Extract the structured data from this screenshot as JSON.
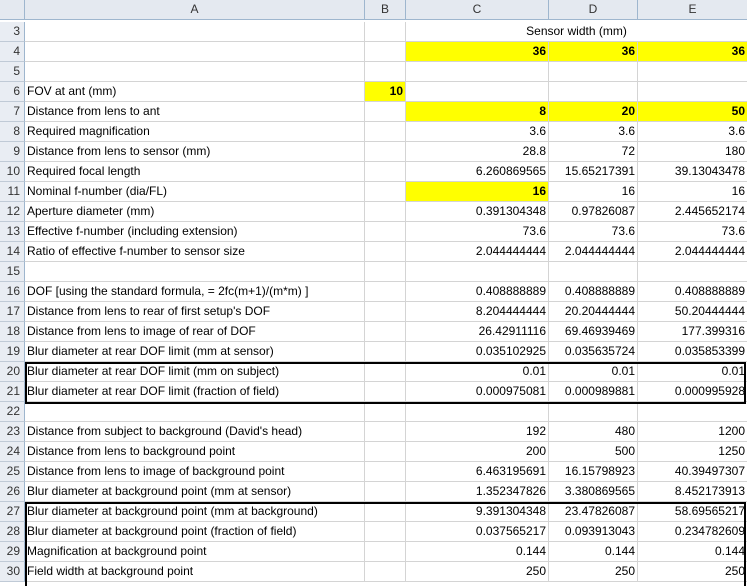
{
  "columns": [
    "A",
    "B",
    "C",
    "D",
    "E"
  ],
  "rows": [
    {
      "n": "3",
      "a": "",
      "b": "",
      "span": "Sensor width (mm)"
    },
    {
      "n": "4",
      "a": "",
      "b": "",
      "c": "36",
      "d": "36",
      "e": "36",
      "hl": [
        "c",
        "d",
        "e"
      ]
    },
    {
      "n": "5",
      "a": "",
      "b": "",
      "c": "",
      "d": "",
      "e": ""
    },
    {
      "n": "6",
      "a": "FOV at ant (mm)",
      "b": "10",
      "c": "",
      "d": "",
      "e": "",
      "hl": [
        "b"
      ]
    },
    {
      "n": "7",
      "a": "Distance from lens to ant",
      "b": "",
      "c": "8",
      "d": "20",
      "e": "50",
      "hl": [
        "c",
        "d",
        "e"
      ]
    },
    {
      "n": "8",
      "a": "Required magnification",
      "b": "",
      "c": "3.6",
      "d": "3.6",
      "e": "3.6"
    },
    {
      "n": "9",
      "a": "Distance from lens to sensor (mm)",
      "b": "",
      "c": "28.8",
      "d": "72",
      "e": "180"
    },
    {
      "n": "10",
      "a": "Required focal length",
      "b": "",
      "c": "6.260869565",
      "d": "15.65217391",
      "e": "39.13043478"
    },
    {
      "n": "11",
      "a": "Nominal f-number (dia/FL)",
      "b": "",
      "c": "16",
      "d": "16",
      "e": "16",
      "hl": [
        "c"
      ]
    },
    {
      "n": "12",
      "a": "Aperture diameter (mm)",
      "b": "",
      "c": "0.391304348",
      "d": "0.97826087",
      "e": "2.445652174"
    },
    {
      "n": "13",
      "a": "Effective f-number (including extension)",
      "b": "",
      "c": "73.6",
      "d": "73.6",
      "e": "73.6"
    },
    {
      "n": "14",
      "a": "Ratio of effective f-number to sensor size",
      "b": "",
      "c": "2.044444444",
      "d": "2.044444444",
      "e": "2.044444444"
    },
    {
      "n": "15",
      "a": "",
      "b": "",
      "c": "",
      "d": "",
      "e": ""
    },
    {
      "n": "16",
      "a": "DOF [using the standard formula, = 2fc(m+1)/(m*m) ]",
      "b": "",
      "c": "0.408888889",
      "d": "0.408888889",
      "e": "0.408888889"
    },
    {
      "n": "17",
      "a": "Distance from lens to rear of first setup's DOF",
      "b": "",
      "c": "8.204444444",
      "d": "20.20444444",
      "e": "50.20444444"
    },
    {
      "n": "18",
      "a": "Distance from lens to image of rear of DOF",
      "b": "",
      "c": "26.42911116",
      "d": "69.46939469",
      "e": "177.399316"
    },
    {
      "n": "19",
      "a": "Blur diameter at rear DOF limit (mm at sensor)",
      "b": "",
      "c": "0.035102925",
      "d": "0.035635724",
      "e": "0.035853399"
    },
    {
      "n": "20",
      "a": "Blur diameter at rear DOF limit (mm on subject)",
      "b": "",
      "c": "0.01",
      "d": "0.01",
      "e": "0.01"
    },
    {
      "n": "21",
      "a": "Blur diameter at rear DOF limit (fraction of field)",
      "b": "",
      "c": "0.000975081",
      "d": "0.000989881",
      "e": "0.000995928"
    },
    {
      "n": "22",
      "a": "",
      "b": "",
      "c": "",
      "d": "",
      "e": ""
    },
    {
      "n": "23",
      "a": "Distance from subject to background (David's head)",
      "b": "",
      "c": "192",
      "d": "480",
      "e": "1200"
    },
    {
      "n": "24",
      "a": "Distance from lens to background point",
      "b": "",
      "c": "200",
      "d": "500",
      "e": "1250"
    },
    {
      "n": "25",
      "a": "Distance from lens to image of background point",
      "b": "",
      "c": "6.463195691",
      "d": "16.15798923",
      "e": "40.39497307"
    },
    {
      "n": "26",
      "a": "Blur diameter at background point (mm at sensor)",
      "b": "",
      "c": "1.352347826",
      "d": "3.380869565",
      "e": "8.452173913"
    },
    {
      "n": "27",
      "a": "Blur diameter at background point (mm at background)",
      "b": "",
      "c": "9.391304348",
      "d": "23.47826087",
      "e": "58.69565217"
    },
    {
      "n": "28",
      "a": "Blur diameter at background point (fraction of field)",
      "b": "",
      "c": "0.037565217",
      "d": "0.093913043",
      "e": "0.234782609"
    },
    {
      "n": "29",
      "a": "Magnification at background point",
      "b": "",
      "c": "0.144",
      "d": "0.144",
      "e": "0.144"
    },
    {
      "n": "30",
      "a": "Field width at background point",
      "b": "",
      "c": "250",
      "d": "250",
      "e": "250"
    }
  ],
  "colors": {
    "highlight": "#ffff00",
    "header_bg": "#e4e9f0",
    "gridline": "#d4d4d4"
  }
}
